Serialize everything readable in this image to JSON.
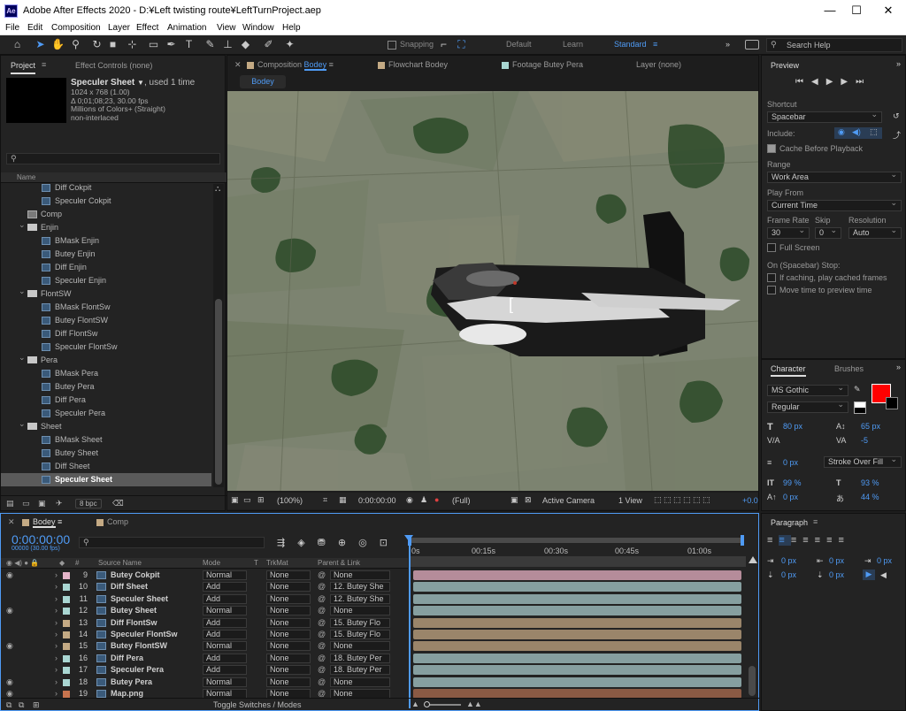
{
  "window": {
    "title": "Adobe After Effects 2020 - D:¥Left twisting route¥LeftTurnProject.aep",
    "icon": "Ae",
    "min": "—",
    "max": "☐",
    "close": "✕"
  },
  "menu": [
    "File",
    "Edit",
    "Composition",
    "Layer",
    "Effect",
    "Animation",
    "View",
    "Window",
    "Help"
  ],
  "toolbar": {
    "snapping": "Snapping",
    "workspaces": [
      "Default",
      "Learn",
      "Standard"
    ],
    "active_ws": "Standard",
    "search_help": "Search Help"
  },
  "project": {
    "tab": "Project",
    "effect_controls": "Effect Controls (none)",
    "item_name": "Speculer Sheet",
    "item_used": ", used 1 time",
    "item_info": [
      "1024 x 768 (1.00)",
      "Δ 0;01;08;23, 30.00 fps",
      "Millions of Colors+ (Straight)",
      "non-interlaced"
    ],
    "col_name": "Name",
    "items": [
      {
        "label": "Diff Cokpit",
        "type": "file",
        "indent": 1
      },
      {
        "label": "Speculer Cokpit",
        "type": "file",
        "indent": 1
      },
      {
        "label": "Comp",
        "type": "comp",
        "indent": 0
      },
      {
        "label": "Enjin",
        "type": "folder",
        "indent": 0
      },
      {
        "label": "BMask Enjin",
        "type": "file",
        "indent": 1
      },
      {
        "label": "Butey Enjin",
        "type": "file",
        "indent": 1
      },
      {
        "label": "Diff Enjin",
        "type": "file",
        "indent": 1
      },
      {
        "label": "Speculer Enjin",
        "type": "file",
        "indent": 1
      },
      {
        "label": "FlontSW",
        "type": "folder",
        "indent": 0
      },
      {
        "label": "BMask FlontSw",
        "type": "file",
        "indent": 1
      },
      {
        "label": "Butey FlontSW",
        "type": "file",
        "indent": 1
      },
      {
        "label": "Diff FlontSw",
        "type": "file",
        "indent": 1
      },
      {
        "label": "Speculer FlontSw",
        "type": "file",
        "indent": 1
      },
      {
        "label": "Pera",
        "type": "folder",
        "indent": 0
      },
      {
        "label": "BMask Pera",
        "type": "file",
        "indent": 1
      },
      {
        "label": "Butey Pera",
        "type": "file",
        "indent": 1
      },
      {
        "label": "Diff Pera",
        "type": "file",
        "indent": 1
      },
      {
        "label": "Speculer Pera",
        "type": "file",
        "indent": 1
      },
      {
        "label": "Sheet",
        "type": "folder",
        "indent": 0
      },
      {
        "label": "BMask Sheet",
        "type": "file",
        "indent": 1
      },
      {
        "label": "Butey Sheet",
        "type": "file",
        "indent": 1
      },
      {
        "label": "Diff Sheet",
        "type": "file",
        "indent": 1
      },
      {
        "label": "Speculer Sheet",
        "type": "file",
        "indent": 1,
        "selected": true
      }
    ],
    "bpc": "8 bpc"
  },
  "composition": {
    "tab_prefix": "Composition",
    "tab_name": "Bodey",
    "flowchart": "Flowchart  Bodey",
    "footage": "Footage  Butey Pera",
    "layer": "Layer  (none)",
    "crumb": "Bodey",
    "zoom": "(100%)",
    "timecode": "0:00:00:00",
    "resolution": "(Full)",
    "camera": "Active Camera",
    "view": "1 View",
    "exposure": "+0.0"
  },
  "preview": {
    "tab": "Preview",
    "shortcut_label": "Shortcut",
    "shortcut": "Spacebar",
    "include": "Include:",
    "cache": "Cache Before Playback",
    "range_label": "Range",
    "range": "Work Area",
    "playfrom_label": "Play From",
    "playfrom": "Current Time",
    "framerate_label": "Frame Rate",
    "skip_label": "Skip",
    "res_label": "Resolution",
    "framerate": "30",
    "skip": "0",
    "res": "Auto",
    "fullscreen": "Full Screen",
    "stop_label": "On (Spacebar) Stop:",
    "stop1": "If caching, play cached frames",
    "stop2": "Move time to preview time"
  },
  "character": {
    "tab": "Character",
    "brushes": "Brushes",
    "font": "MS Gothic",
    "style": "Regular",
    "size": "80 px",
    "leading": "65 px",
    "kerning": "",
    "tracking": "-5",
    "stroke": "0 px",
    "stroke_type": "Stroke Over Fill",
    "vscale": "99 %",
    "hscale": "93 %",
    "baseline": "0 px",
    "tsume": "44 %",
    "fill_color": "#ff0000"
  },
  "paragraph": {
    "tab": "Paragraph",
    "values": [
      "0 px",
      "0 px",
      "0 px",
      "0 px",
      "0 px"
    ]
  },
  "timeline": {
    "tab_comp": "Bodey",
    "tab_comp2": "Comp",
    "timecode": "0:00:00:00",
    "frames": "00000 (30.00 fps)",
    "headers": {
      "source": "Source Name",
      "mode": "Mode",
      "t": "T",
      "trkmat": "TrkMat",
      "parent": "Parent & Link"
    },
    "ruler": [
      "0s",
      "00:15s",
      "00:30s",
      "00:45s",
      "01:00s"
    ],
    "toggle": "Toggle Switches / Modes",
    "layers": [
      {
        "num": "9",
        "name": "Butey Cokpit",
        "mode": "Normal",
        "trk": "None",
        "parent": "None",
        "label": "#e4b4c8",
        "bar": "#b58c9a",
        "eye": true
      },
      {
        "num": "10",
        "name": "Diff Sheet",
        "mode": "Add",
        "trk": "None",
        "parent": "12. Butey She",
        "label": "#a9d6d2",
        "bar": "#869fa0",
        "eye": false
      },
      {
        "num": "11",
        "name": "Speculer Sheet",
        "mode": "Add",
        "trk": "None",
        "parent": "12. Butey She",
        "label": "#a9d6d2",
        "bar": "#869fa0",
        "eye": false
      },
      {
        "num": "12",
        "name": "Butey Sheet",
        "mode": "Normal",
        "trk": "None",
        "parent": "None",
        "label": "#a9d6d2",
        "bar": "#869fa0",
        "eye": true
      },
      {
        "num": "13",
        "name": "Diff FlontSw",
        "mode": "Add",
        "trk": "None",
        "parent": "15. Butey Flo",
        "label": "#c4aa84",
        "bar": "#9a856a",
        "eye": false
      },
      {
        "num": "14",
        "name": "Speculer FlontSw",
        "mode": "Add",
        "trk": "None",
        "parent": "15. Butey Flo",
        "label": "#c4aa84",
        "bar": "#9a856a",
        "eye": false
      },
      {
        "num": "15",
        "name": "Butey FlontSW",
        "mode": "Normal",
        "trk": "None",
        "parent": "None",
        "label": "#c4aa84",
        "bar": "#9a856a",
        "eye": true
      },
      {
        "num": "16",
        "name": "Diff Pera",
        "mode": "Add",
        "trk": "None",
        "parent": "18. Butey Per",
        "label": "#a9d6d2",
        "bar": "#869fa0",
        "eye": false
      },
      {
        "num": "17",
        "name": "Speculer Pera",
        "mode": "Add",
        "trk": "None",
        "parent": "18. Butey Per",
        "label": "#a9d6d2",
        "bar": "#869fa0",
        "eye": false
      },
      {
        "num": "18",
        "name": "Butey Pera",
        "mode": "Normal",
        "trk": "None",
        "parent": "None",
        "label": "#a9d6d2",
        "bar": "#869fa0",
        "eye": true
      },
      {
        "num": "19",
        "name": "Map.png",
        "mode": "Normal",
        "trk": "None",
        "parent": "None",
        "label": "#c8744e",
        "bar": "#8a5a44",
        "eye": true
      }
    ]
  }
}
